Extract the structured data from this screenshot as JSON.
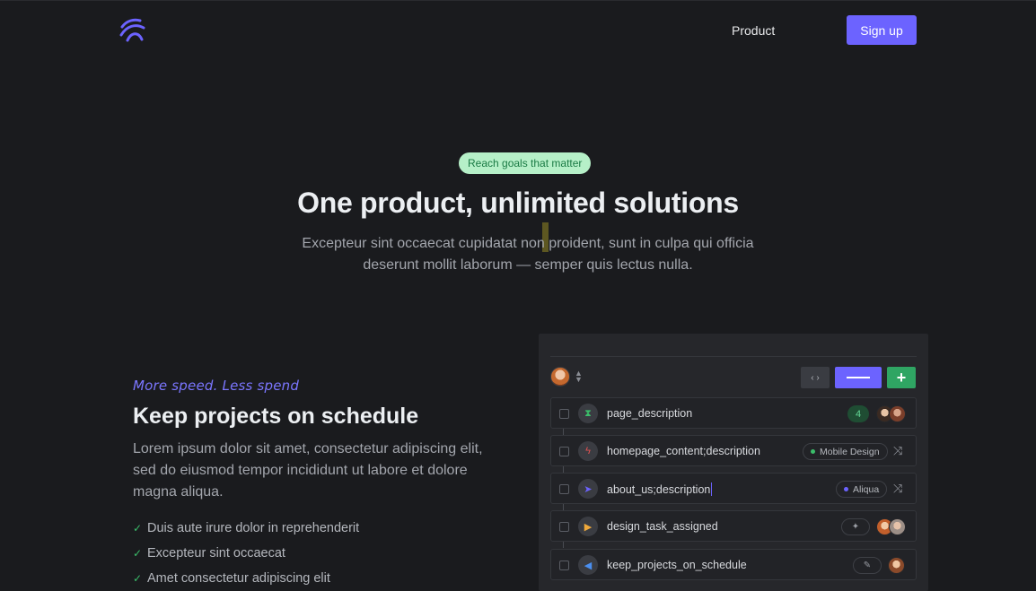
{
  "header": {
    "nav_product": "Product",
    "signup_label": "Sign up",
    "brand_color": "#6c63ff"
  },
  "hero": {
    "badge": "Reach goals that matter",
    "title": "One product, unlimited solutions",
    "subtitle_line1": "Excepteur sint occaecat cupidatat non proident, sunt in culpa qui officia",
    "subtitle_line2": "deserunt mollit laborum — semper quis lectus nulla."
  },
  "feature": {
    "tagline": "More speed. Less spend",
    "title": "Keep projects on schedule",
    "description": "Lorem ipsum dolor sit amet, consectetur adipiscing elit, sed do eiusmod tempor incididunt ut labore et dolore magna aliqua.",
    "checks": [
      "Duis aute irure dolor in reprehenderit",
      "Excepteur sint occaecat",
      "Amet consectetur adipiscing elit"
    ]
  },
  "panel": {
    "rows": [
      {
        "label": "page_description",
        "icon": "hourglass-icon",
        "count": "4"
      },
      {
        "label": "homepage_content;description",
        "icon": "bolt-icon",
        "tag": "Mobile Design",
        "tag_color": "#3bbd6a"
      },
      {
        "label": "about_us;description",
        "icon": "navigation-arrow-icon",
        "tag": "Aliqua",
        "tag_color": "#6c63ff"
      },
      {
        "label": "design_task_assigned",
        "icon": "play-icon"
      },
      {
        "label": "keep_projects_on_schedule",
        "icon": "megaphone-icon"
      }
    ]
  }
}
